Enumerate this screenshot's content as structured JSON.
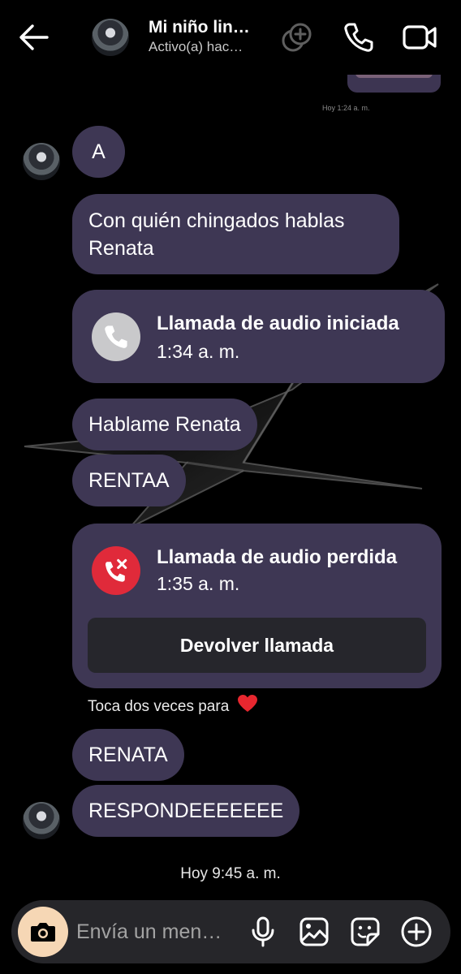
{
  "header": {
    "contact_name": "Mi niño lin…",
    "status": "Activo(a) hac…",
    "icons": [
      "back-arrow-icon",
      "effects-icon",
      "phone-icon",
      "video-icon"
    ]
  },
  "timestamps": {
    "top_small": "Hoy 1:24 a. m.",
    "day": "Hoy 9:45 a. m."
  },
  "messages": [
    {
      "text": "A"
    },
    {
      "text": "Con quién chingados hablas Renata"
    },
    {
      "text": "Hablame Renata"
    },
    {
      "text": "RENTAA"
    },
    {
      "text": "RENATA"
    },
    {
      "text": "RESPONDEEEEEEE"
    }
  ],
  "calls": {
    "started": {
      "title": "Llamada de audio iniciada",
      "time": "1:34 a. m.",
      "icon": "phone-icon"
    },
    "missed": {
      "title": "Llamada de audio perdida",
      "time": "1:35 a. m.",
      "icon": "missed-call-icon",
      "callback_label": "Devolver llamada"
    }
  },
  "hint": "Toca dos veces para",
  "composer": {
    "placeholder": "Envía un men…",
    "icons": [
      "camera-icon",
      "microphone-icon",
      "gallery-icon",
      "sticker-icon",
      "plus-icon"
    ]
  },
  "colors": {
    "bubble": "#3e3754",
    "callback_button": "#26262c",
    "missed_call": "#e02a3a",
    "camera_button": "#f6d7b5"
  }
}
